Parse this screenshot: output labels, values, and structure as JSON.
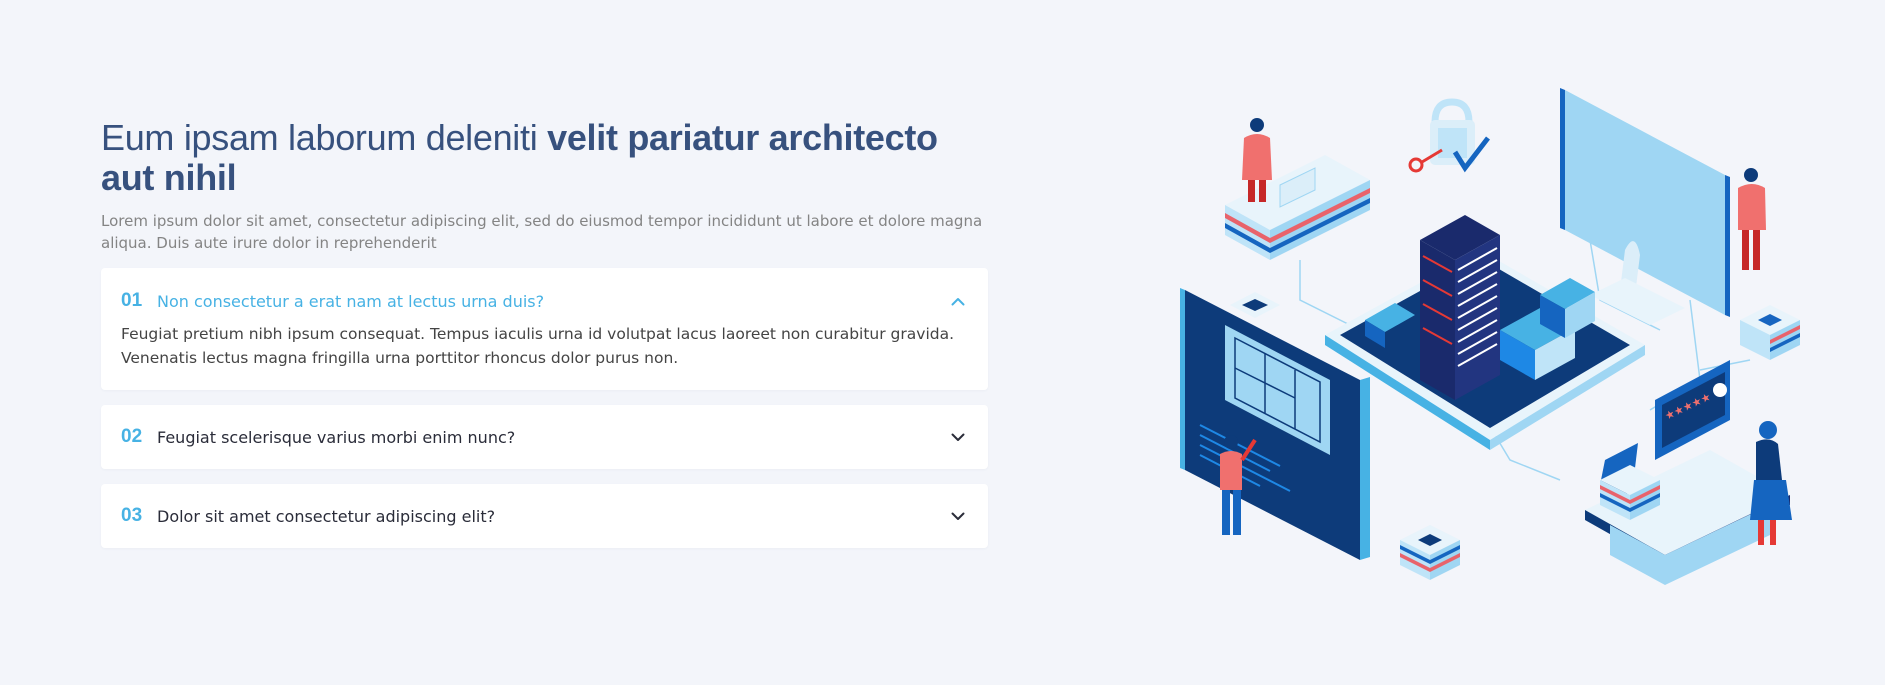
{
  "heading": {
    "light": "Eum ipsam laborum deleniti ",
    "bold": "velit pariatur architecto aut nihil"
  },
  "lead": "Lorem ipsum dolor sit amet, consectetur adipiscing elit, sed do eiusmod tempor incididunt ut labore et dolore magna aliqua. Duis aute irure dolor in reprehenderit",
  "faq": [
    {
      "num": "01",
      "question": "Non consectetur a erat nam at lectus urna duis?",
      "answer": "Feugiat pretium nibh ipsum consequat. Tempus iaculis urna id volutpat lacus laoreet non curabitur gravida. Venenatis lectus magna fringilla urna porttitor rhoncus dolor purus non.",
      "expanded": true,
      "icon": "chevron-up-icon"
    },
    {
      "num": "02",
      "question": "Feugiat scelerisque varius morbi enim nunc?",
      "expanded": false,
      "icon": "chevron-down-icon"
    },
    {
      "num": "03",
      "question": "Dolor sit amet consectetur adipiscing elit?",
      "expanded": false,
      "icon": "chevron-down-icon"
    }
  ],
  "colors": {
    "accent": "#47b2e4",
    "heading": "#37517e",
    "background": "#f3f5fa"
  },
  "illustration": {
    "icon": "isometric-smart-city-illustration"
  }
}
